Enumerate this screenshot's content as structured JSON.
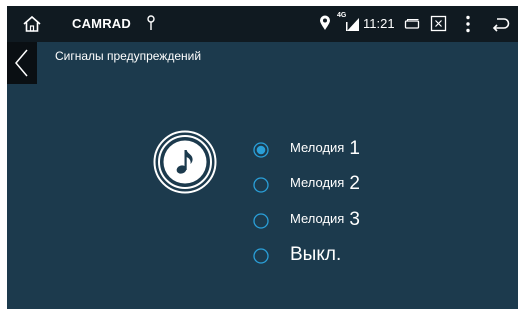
{
  "statusbar": {
    "app_name": "CAMRAD",
    "network_type": "4G",
    "time": "11:21",
    "icons": [
      "home-icon",
      "usb-icon",
      "location-icon",
      "signal-icon",
      "window-icon",
      "screenshot-icon",
      "overflow-menu-icon",
      "back-icon"
    ]
  },
  "page": {
    "title": "Сигналы предупреждений",
    "back_icon": "chevron-left-icon",
    "center_icon": "music-note-icon"
  },
  "options": [
    {
      "word": "Мелодия",
      "number": "1",
      "selected": true
    },
    {
      "word": "Мелодия",
      "number": "2",
      "selected": false
    },
    {
      "word": "Мелодия",
      "number": "3",
      "selected": false
    },
    {
      "label": "Выкл.",
      "selected": false
    }
  ],
  "colors": {
    "background": "#1c3a4d",
    "statusbar": "#101a21",
    "accent": "#2a9fd8"
  }
}
